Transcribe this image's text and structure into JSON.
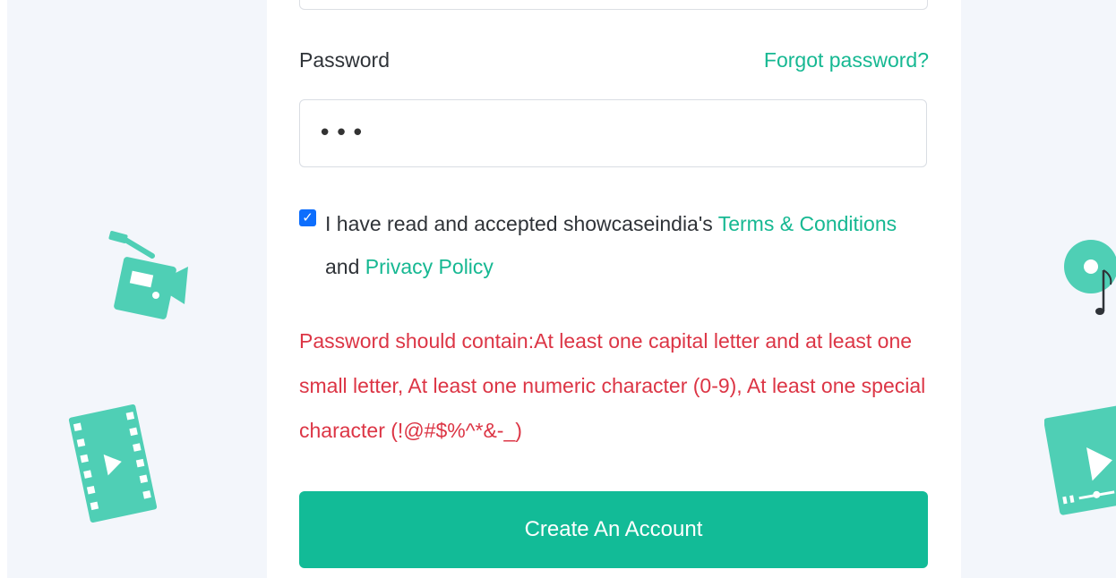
{
  "form": {
    "password_label": "Password",
    "forgot_password_link": "Forgot password?",
    "password_value": "•••",
    "terms": {
      "checked": true,
      "check_mark": "✓",
      "prefix": "I have read and accepted showcaseindia's ",
      "terms_link": "Terms & Conditions",
      "middle": " and ",
      "privacy_link": "Privacy Policy"
    },
    "error_message": "Password should contain:At least one capital letter and at least one small letter, At least one numeric character (0-9), At least one special character (!@#$%^*&-_)",
    "submit_label": "Create An Account"
  },
  "decorations": {
    "left": [
      "video-camera-icon",
      "film-strip-icon"
    ],
    "right": [
      "music-disc-icon",
      "video-player-icon"
    ],
    "accent_color": "#4fcfb5"
  },
  "colors": {
    "accent": "#16b892",
    "button": "#12bb97",
    "error": "#dc3545",
    "checkbox": "#0d6efd",
    "background": "#f3f6fb"
  }
}
